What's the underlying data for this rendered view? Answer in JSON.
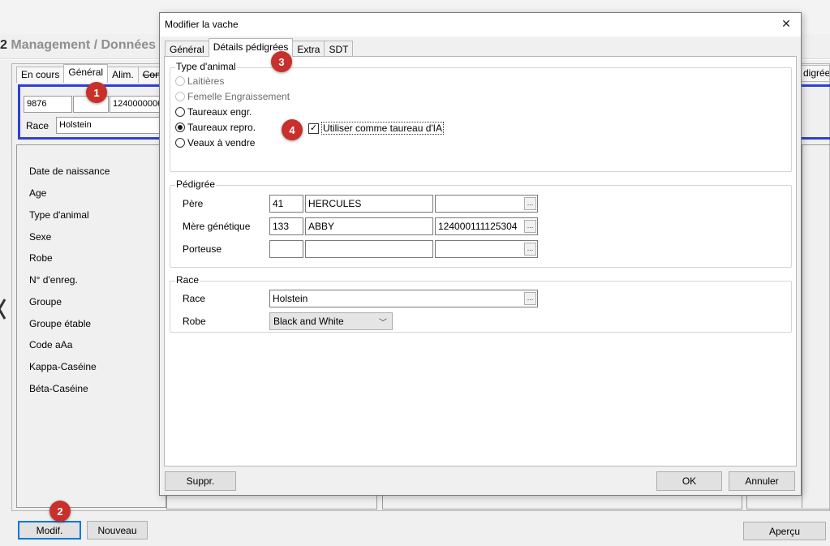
{
  "background": {
    "title_number": "2",
    "title_text": "Management / Données",
    "tabs": [
      {
        "label": "En cours",
        "active": false,
        "strike": false
      },
      {
        "label": "Général",
        "active": true,
        "strike": false
      },
      {
        "label": "Alim.",
        "active": false,
        "strike": false
      },
      {
        "label": "Con",
        "active": false,
        "strike": true
      }
    ],
    "tab_right": "digrée",
    "id_number": "9876",
    "id_empty": "",
    "id_long": "1240000006",
    "race_label": "Race",
    "race_value": "Holstein",
    "fields": [
      "Date de naissance",
      "Age",
      "Type d'animal",
      "Sexe",
      "Robe",
      "N° d'enreg.",
      "Groupe",
      "Groupe étable",
      "Code aAa",
      "Kappa-Caséine",
      "Béta-Caséine"
    ],
    "buttons": {
      "modif": "Modif.",
      "nouveau": "Nouveau",
      "apercu": "Aperçu"
    }
  },
  "dialog": {
    "title": "Modifier la vache",
    "close_glyph": "✕",
    "tabs": [
      {
        "label": "Général",
        "active": false
      },
      {
        "label": "Détails pédigrées",
        "active": true
      },
      {
        "label": "Extra",
        "active": false
      },
      {
        "label": "SDT",
        "active": false
      }
    ],
    "type_animal": {
      "title": "Type d'animal",
      "options": [
        {
          "label": "Laitières",
          "state": "disabled"
        },
        {
          "label": "Femelle Engraissement",
          "state": "disabled"
        },
        {
          "label": "Taureaux engr.",
          "state": "unchecked"
        },
        {
          "label": "Taureaux repro.",
          "state": "checked"
        },
        {
          "label": "Veaux à vendre",
          "state": "unchecked"
        }
      ],
      "checkbox_label": "Utiliser comme taureau d'IA",
      "checkbox_checked": true,
      "checkbox_glyph": "✓"
    },
    "pedigree": {
      "title": "Pédigrée",
      "rows": [
        {
          "label": "Père",
          "num": "41",
          "name": "HERCULES",
          "code": ""
        },
        {
          "label": "Mère génétique",
          "num": "133",
          "name": "ABBY",
          "code": "124000111125304"
        },
        {
          "label": "Porteuse",
          "num": "",
          "name": "",
          "code": ""
        }
      ],
      "ellipsis": "..."
    },
    "race": {
      "title": "Race",
      "race_label": "Race",
      "race_value": "Holstein",
      "robe_label": "Robe",
      "robe_value": "Black and White",
      "ellipsis": "...",
      "dropdown_glyph": "﹀"
    },
    "buttons": {
      "suppr": "Suppr.",
      "ok": "OK",
      "annuler": "Annuler"
    }
  },
  "markers": [
    "1",
    "2",
    "3",
    "4"
  ],
  "colors": {
    "focus_blue": "#2f3fd8",
    "marker_red": "#c7302b",
    "dialog_bg": "#f0f0f0",
    "page_bg": "#ffffff"
  }
}
